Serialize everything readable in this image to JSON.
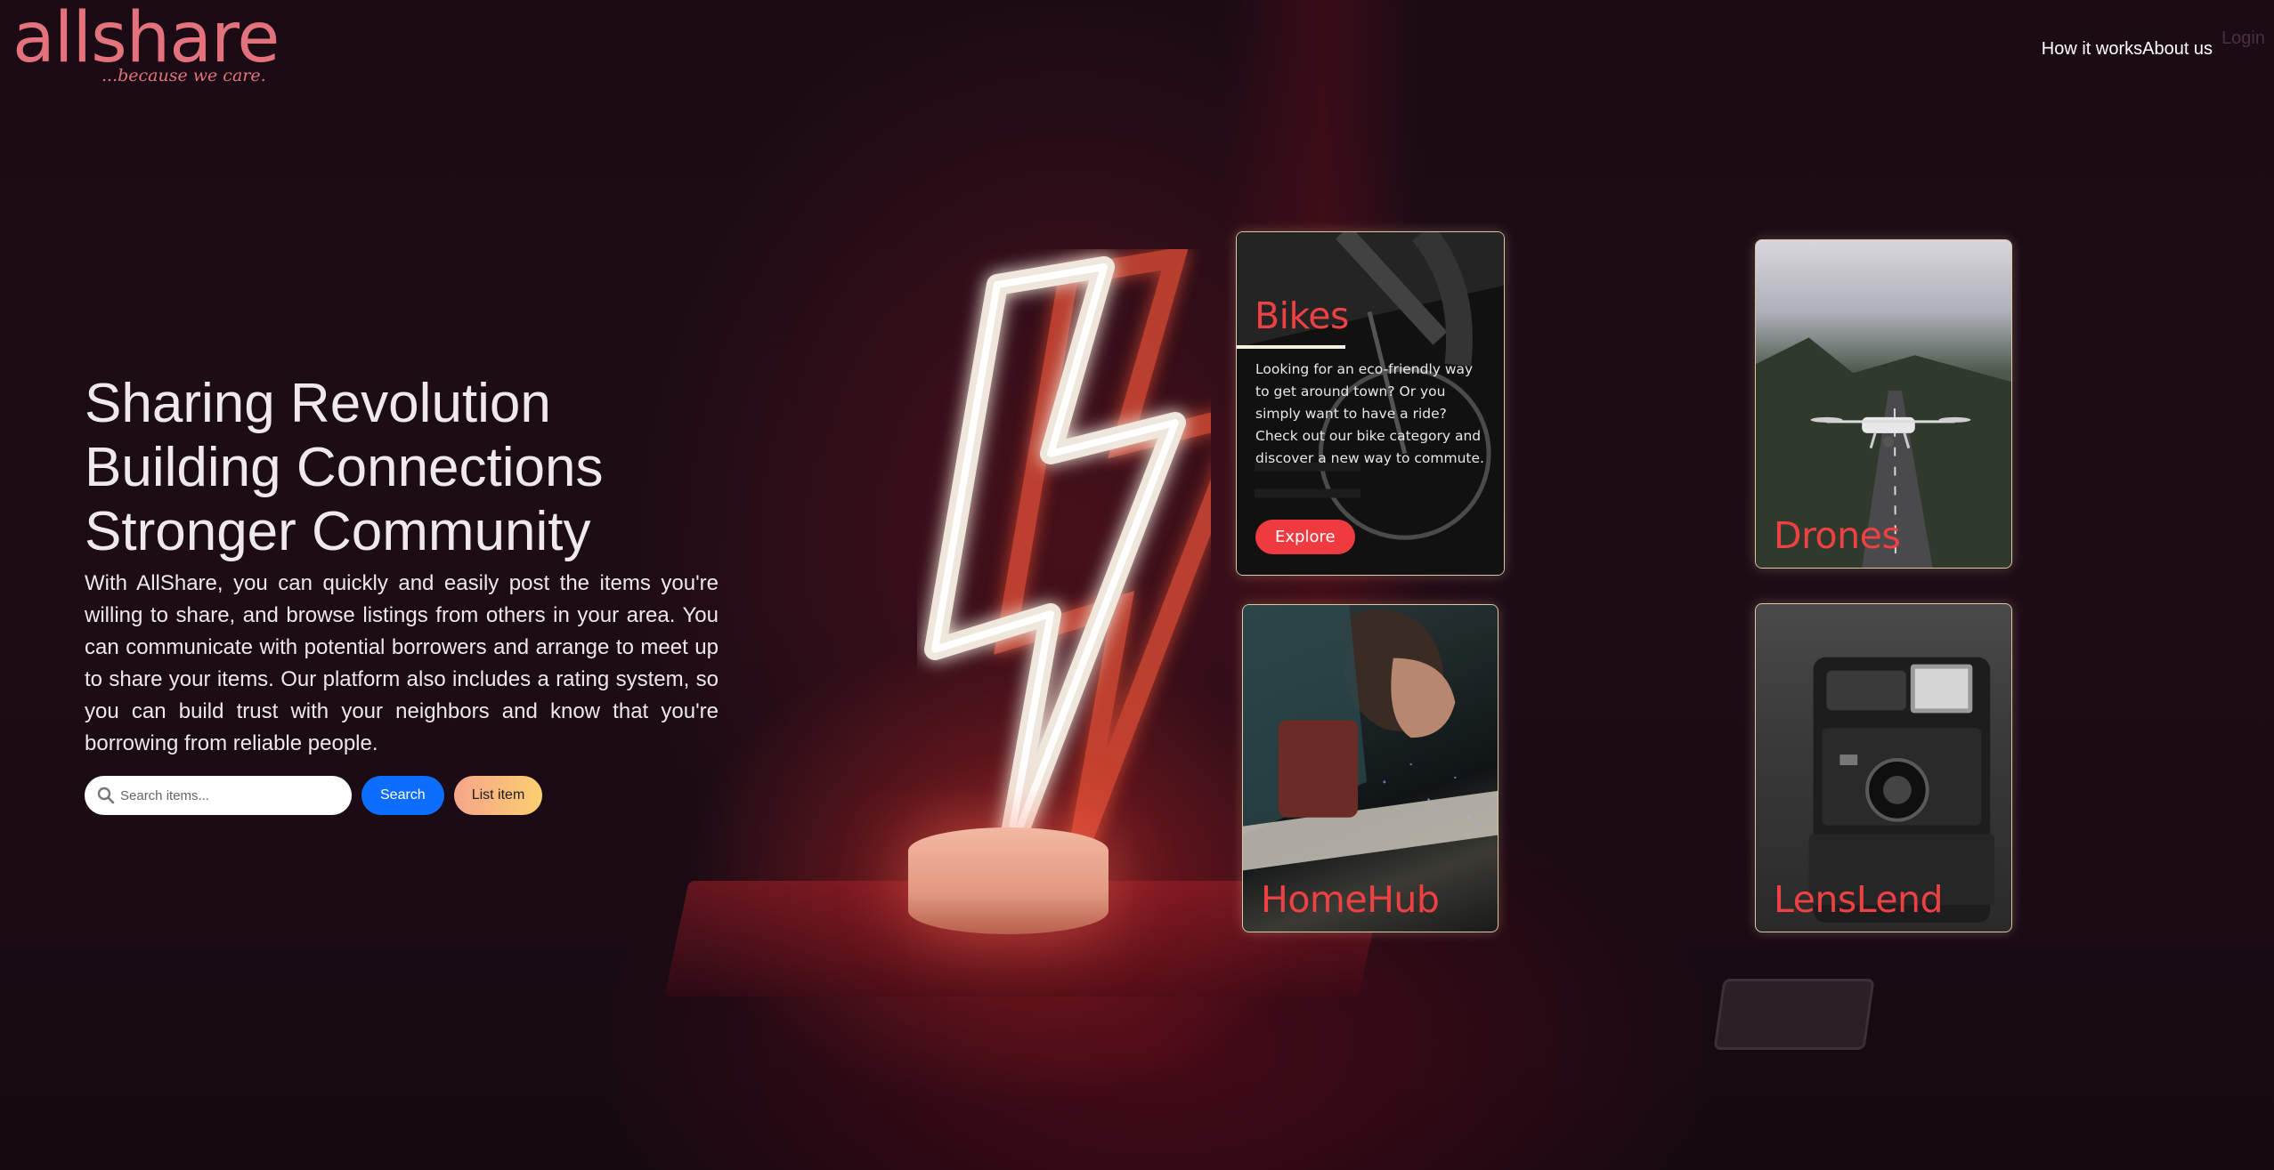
{
  "header": {
    "logo_text": "allshare",
    "logo_tagline": "...because we care.",
    "nav": [
      {
        "label": "How it works"
      },
      {
        "label": "About us"
      }
    ],
    "login_label": "Login"
  },
  "hero": {
    "headline": [
      "Sharing Revolution",
      "Building Connections",
      "Stronger Community"
    ],
    "description": "With AllShare, you can quickly and easily post the items you're willing to share, and browse listings from others in your area. You can communicate with potential borrowers and arrange to meet up to share your items. Our platform also includes a rating system, so you can build trust with your neighbors and know that you're borrowing from reliable people.",
    "search_placeholder": "Search items...",
    "search_value": "",
    "search_button": "Search",
    "list_button": "List item"
  },
  "categories": [
    {
      "title": "Bikes",
      "description": "Looking for an eco-friendly way to get around town? Or you simply want to have a ride? Check out our bike category and discover a new way to commute.",
      "button": "Explore"
    },
    {
      "title": "Drones"
    },
    {
      "title": "HomeHub"
    },
    {
      "title": "LensLend"
    }
  ],
  "colors": {
    "brand": "#e4727d",
    "card_title": "#ef4144",
    "search_button": "#0d6efd",
    "list_button_gradient": [
      "#f6a58a",
      "#fbcf70"
    ],
    "background": "#170a14"
  },
  "icons": {
    "search": "magnifier-icon",
    "hero_image": "lightning-bolt-neon"
  }
}
